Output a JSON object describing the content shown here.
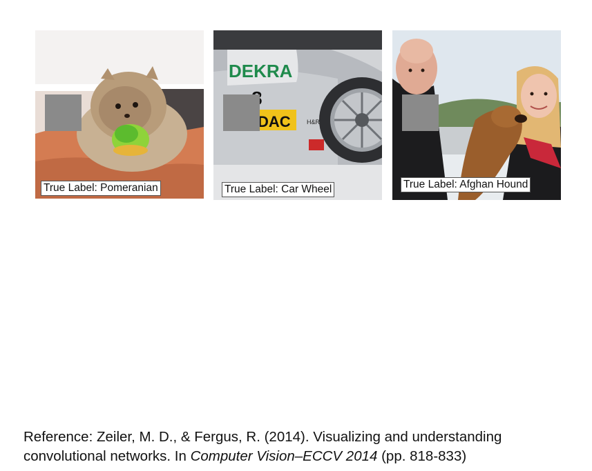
{
  "panels": [
    {
      "label": "True Label: Pomeranian"
    },
    {
      "label": "True Label: Car Wheel",
      "car_text_1": "DEKRA",
      "car_text_2": "8",
      "car_text_3": "DAC",
      "car_text_4": "H&R"
    },
    {
      "label": "True Label: Afghan Hound"
    }
  ],
  "reference": {
    "prefix": "Reference: Zeiler, M. D., & Fergus, R. (2014). Visualizing and understanding convolutional networks. In ",
    "venue": "Computer Vision–ECCV 2014",
    "suffix": " (pp. 818-833)"
  }
}
